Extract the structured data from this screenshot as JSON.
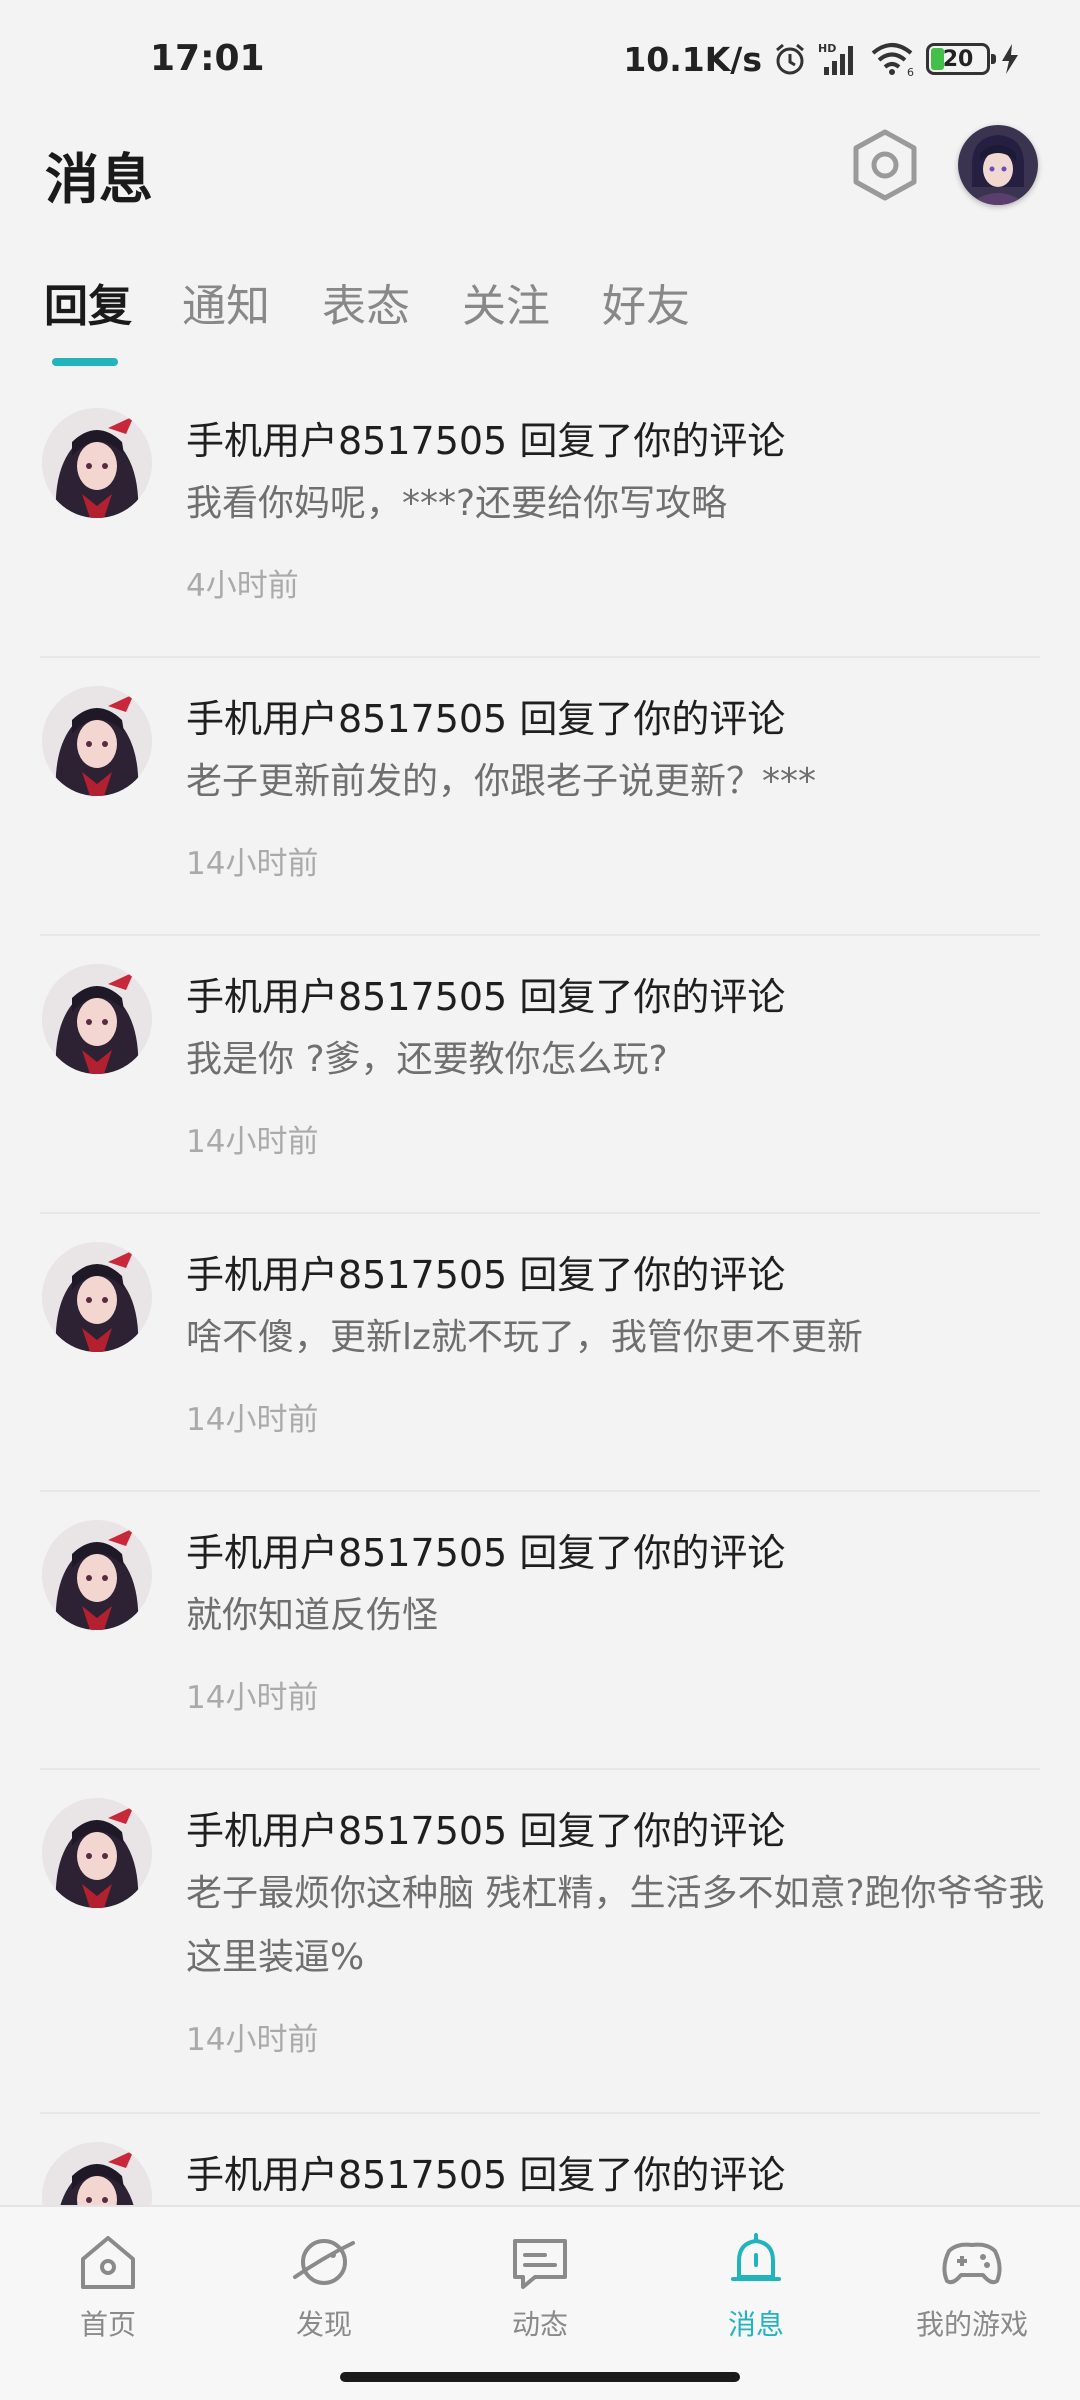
{
  "status_bar": {
    "time": "17:01",
    "net_speed": "10.1K/s",
    "battery": "20",
    "icons": [
      "alarm-icon",
      "signal-icon",
      "wifi-icon",
      "battery-icon",
      "charging-icon"
    ]
  },
  "header": {
    "title": "消息",
    "settings_icon": "settings-hexagon-icon",
    "avatar_icon": "user-avatar"
  },
  "tabs": [
    {
      "label": "回复",
      "active": true
    },
    {
      "label": "通知",
      "active": false
    },
    {
      "label": "表态",
      "active": false
    },
    {
      "label": "关注",
      "active": false
    },
    {
      "label": "好友",
      "active": false
    }
  ],
  "messages": [
    {
      "title": "手机用户8517505 回复了你的评论",
      "body": "我看你妈呢，***?还要给你写攻略",
      "time": "4小时前"
    },
    {
      "title": "手机用户8517505 回复了你的评论",
      "body": "老子更新前发的，你跟老子说更新？***",
      "time": "14小时前"
    },
    {
      "title": "手机用户8517505 回复了你的评论",
      "body": "我是你 ?爹，还要教你怎么玩?",
      "time": "14小时前"
    },
    {
      "title": "手机用户8517505 回复了你的评论",
      "body": "啥不傻，更新lz就不玩了，我管你更不更新",
      "time": "14小时前"
    },
    {
      "title": "手机用户8517505 回复了你的评论",
      "body": "就你知道反伤怪",
      "time": "14小时前"
    },
    {
      "title": "手机用户8517505 回复了你的评论",
      "body": "老子最烦你这种脑 残杠精，生活多不如意?跑你爷爷我这里装逼%",
      "time": "14小时前"
    },
    {
      "title": "手机用户8517505 回复了你的评论",
      "body": "",
      "time": ""
    }
  ],
  "bottom_nav": [
    {
      "label": "首页",
      "icon": "home-icon",
      "active": false
    },
    {
      "label": "发现",
      "icon": "planet-icon",
      "active": false
    },
    {
      "label": "动态",
      "icon": "chat-bubble-icon",
      "active": false
    },
    {
      "label": "消息",
      "icon": "bell-icon",
      "active": true
    },
    {
      "label": "我的游戏",
      "icon": "gamepad-icon",
      "active": false
    }
  ],
  "colors": {
    "accent": "#21b4bd",
    "background": "#f3f3f3",
    "battery_fill": "#43c04a"
  }
}
